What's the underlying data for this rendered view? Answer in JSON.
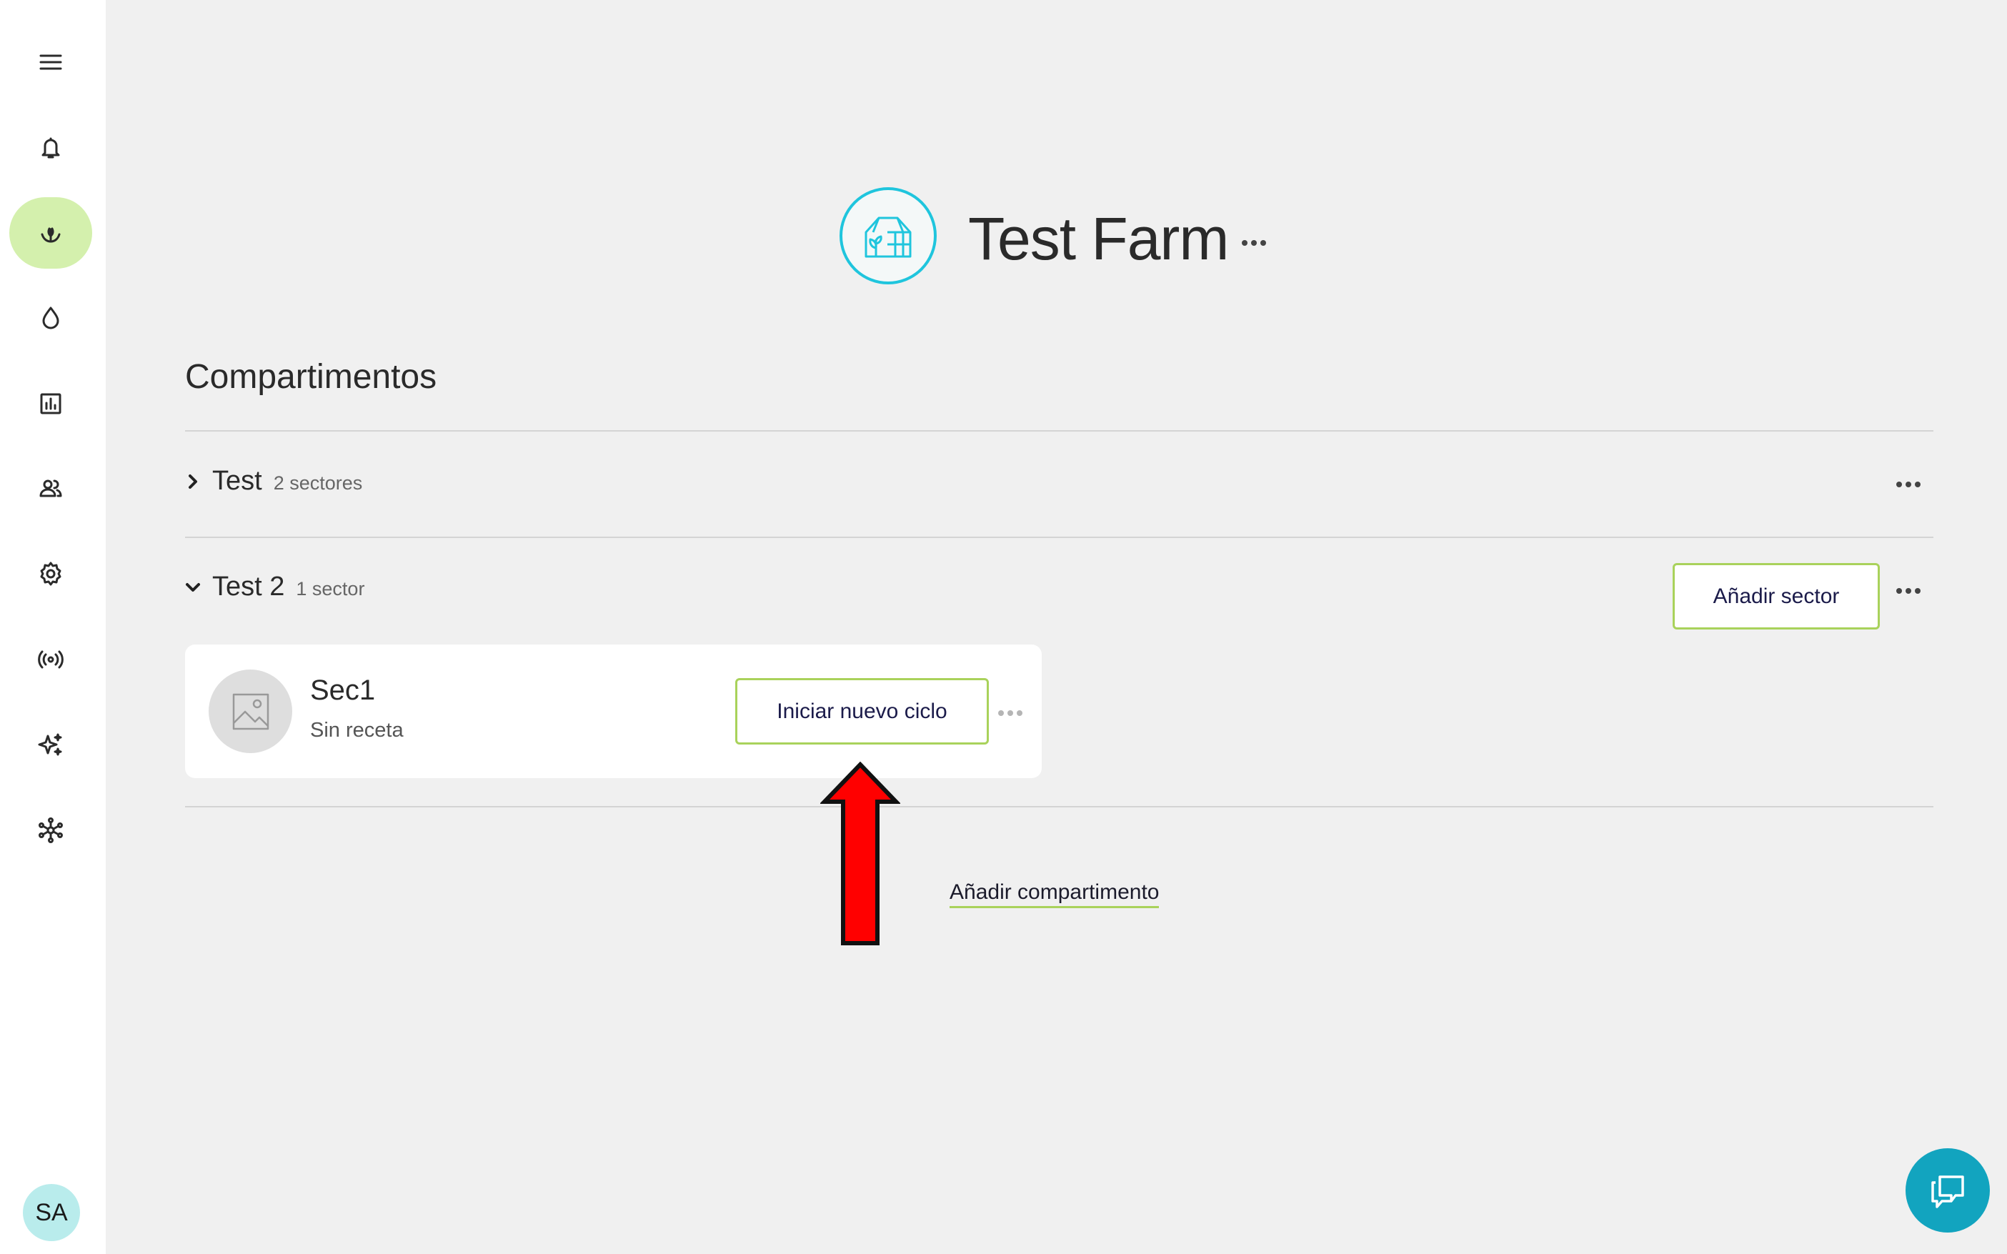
{
  "sidebar": {
    "items": [
      {
        "icon": "menu-icon"
      },
      {
        "icon": "bell-icon"
      },
      {
        "icon": "sprout-icon",
        "active": true
      },
      {
        "icon": "drop-icon"
      },
      {
        "icon": "chart-icon"
      },
      {
        "icon": "users-icon"
      },
      {
        "icon": "gear-icon"
      },
      {
        "icon": "signal-icon"
      },
      {
        "icon": "sparkles-icon"
      },
      {
        "icon": "network-icon"
      }
    ],
    "avatar_initials": "SA"
  },
  "header": {
    "farm_name": "Test Farm",
    "farm_icon": "greenhouse-icon"
  },
  "main": {
    "section_title": "Compartimentos",
    "compartments": [
      {
        "name": "Test",
        "count": "2 sectores",
        "expanded": false
      },
      {
        "name": "Test 2",
        "count": "1 sector",
        "expanded": true,
        "add_sector_label": "Añadir sector"
      }
    ],
    "sector": {
      "name": "Sec1",
      "subtitle": "Sin receta",
      "start_cycle_label": "Iniciar nuevo ciclo"
    },
    "add_compartment_label": "Añadir compartimento"
  },
  "colors": {
    "accent_green": "#a9d25b",
    "active_nav": "#d4f0ad",
    "farm_icon": "#1fc5dd",
    "chat_button": "#12a4bf",
    "annotation_arrow": "#ff0000"
  }
}
